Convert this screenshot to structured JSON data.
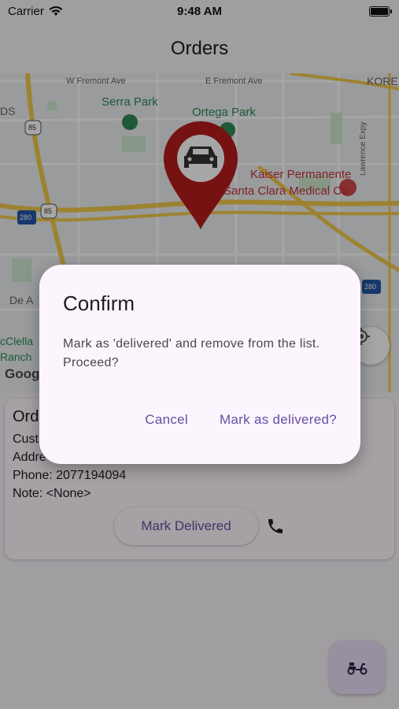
{
  "status_bar": {
    "carrier": "Carrier",
    "time": "9:48 AM"
  },
  "app_bar": {
    "title": "Orders"
  },
  "map": {
    "labels": {
      "w_fremont": "W Fremont Ave",
      "e_fremont": "E Fremont Ave",
      "kore": "KORE",
      "ds": "DS",
      "serra_park": "Serra Park",
      "ortega_park": "Ortega Park",
      "kaiser_1": "Kaiser Permanente",
      "kaiser_2": "Santa Clara Medical Ctr",
      "lawrence": "Lawrence Expy",
      "route_85a": "85",
      "route_85b": "85",
      "route_280a": "280",
      "route_280b": "280",
      "de_a": "De A",
      "mcclella": "cClella",
      "ranch": "Ranch",
      "google": "Google"
    },
    "pin_icon": "car-icon",
    "locate_icon": "my-location-icon"
  },
  "order": {
    "title": "Orde",
    "customer": "Cust",
    "address": "Addre",
    "phone": "Phone: 2077194094",
    "note": "Note: <None>",
    "mark_delivered": "Mark Delivered",
    "phone_icon": "phone-icon"
  },
  "fab": {
    "icon": "delivery-scooter-icon"
  },
  "dialog": {
    "title": "Confirm",
    "body": "Mark as 'delivered' and remove from the list. Proceed?",
    "cancel": "Cancel",
    "confirm": "Mark as delivered?"
  },
  "colors": {
    "accent": "#6750a4",
    "pin": "#b71c1c",
    "road": "#f2c94c"
  }
}
